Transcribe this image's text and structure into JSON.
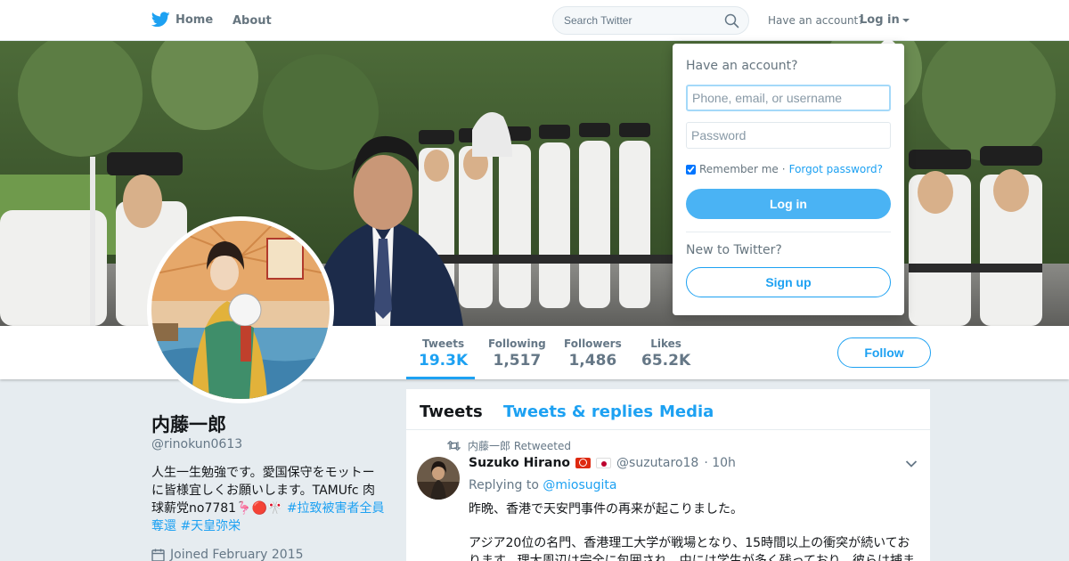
{
  "nav": {
    "home_label": "Home",
    "about_label": "About",
    "search_placeholder": "Search Twitter",
    "have_account": "Have an account?",
    "login_label": "Log in"
  },
  "profile": {
    "name": "内藤一郎",
    "handle": "@rinokun0613",
    "bio_line1": "人生一生勉強です。愛国保守をモットー",
    "bio_line2": "に皆様宜しくお願いします。TAMUfc 肉",
    "bio_line3_text": "球薪党no7781",
    "bio_emoji": "🦩🔴🎌",
    "bio_tag1": "#拉致被害者全員",
    "bio_tag1_cont": "奪還",
    "bio_tag2": "#天皇弥栄",
    "joined": "Joined February 2015"
  },
  "stats": [
    {
      "label": "Tweets",
      "value": "19.3K"
    },
    {
      "label": "Following",
      "value": "1,517"
    },
    {
      "label": "Followers",
      "value": "1,486"
    },
    {
      "label": "Likes",
      "value": "65.2K"
    }
  ],
  "follow_label": "Follow",
  "timeline": {
    "tabs": [
      "Tweets",
      "Tweets & replies",
      "Media"
    ],
    "tweet": {
      "retweeted_by": "内藤一郎 Retweeted",
      "name": "Suzuko Hirano",
      "handle": "@suzutaro18",
      "time": "· 10h",
      "replying_to_label": "Replying to",
      "replying_to_handle": "@miosugita",
      "text1": "昨晩、香港で天安門事件の再来が起こりました。",
      "text2": "アジア20位の名門、香港理工大学が戦場となり、15時間以上の衝突が続いております。理大周辺は完全に包囲され、中には学生が多く残っており、彼らは捕ま"
    }
  },
  "login_dropdown": {
    "title": "Have an account?",
    "username_placeholder": "Phone, email, or username",
    "password_placeholder": "Password",
    "remember_label": "Remember me",
    "separator": "·",
    "forgot_label": "Forgot password?",
    "login_button": "Log in",
    "new_label": "New to Twitter?",
    "signup_button": "Sign up"
  },
  "colors": {
    "accent": "#1da1f2",
    "login_button": "#4ab3f4",
    "page_bg": "#e6ecf0"
  }
}
